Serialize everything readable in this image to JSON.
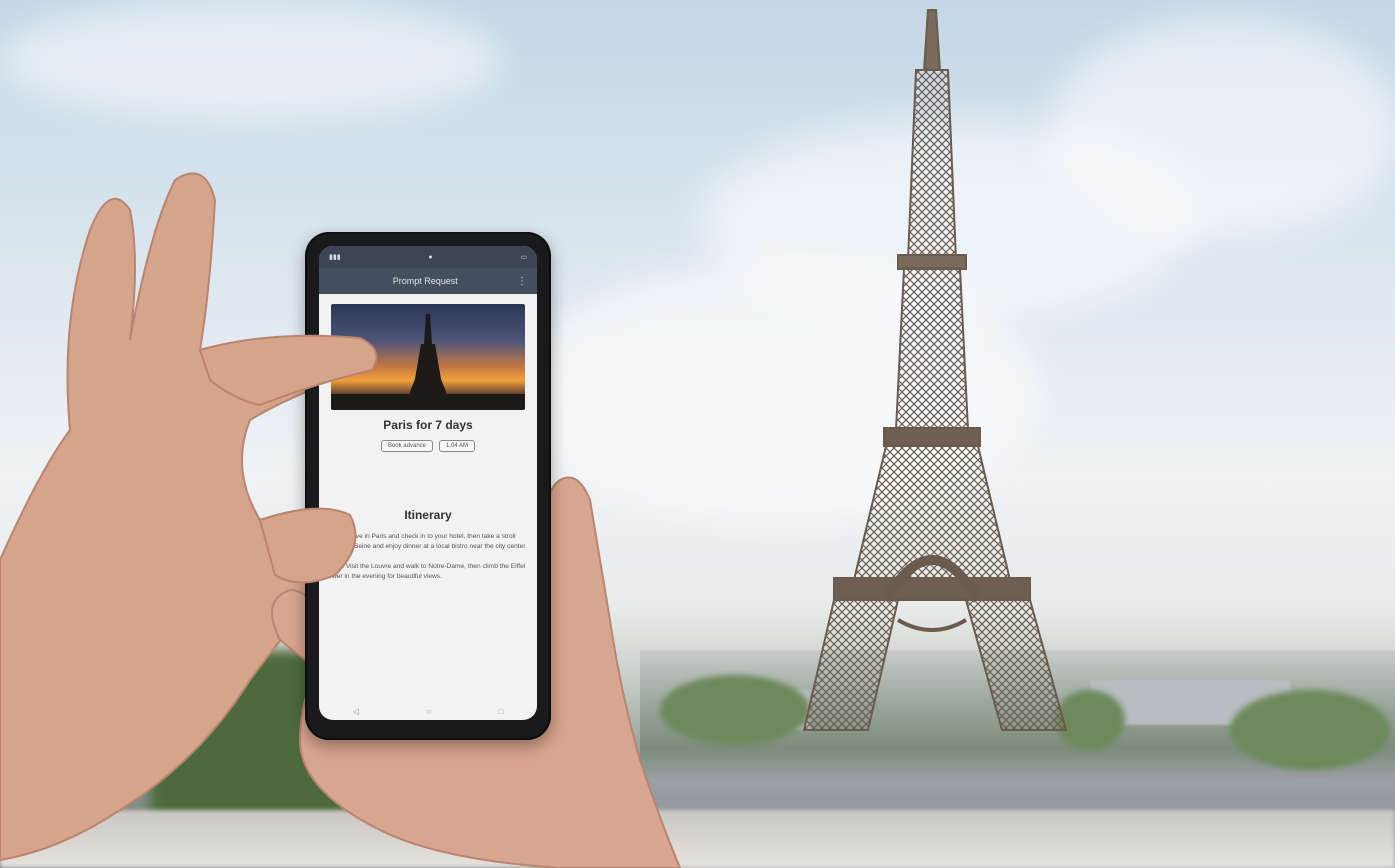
{
  "phone": {
    "status_time": "",
    "app_title": "Prompt Request",
    "trip": {
      "title": "Paris for 7 days",
      "chips": [
        "Book advance",
        "1.04 AM"
      ]
    },
    "itinerary": {
      "heading": "Itinerary",
      "paragraphs": [
        "Day 1: Arrive in Paris and check in to your hotel, then take a stroll along the Seine and enjoy dinner at a local bistro near the city center.",
        "Day 2: Visit the Louvre and walk to Notre-Dame, then climb the Eiffel Tower in the evening for beautiful views."
      ]
    }
  },
  "colors": {
    "sky": "#c4d7e6",
    "tower": "#7a6a5c",
    "skin": "#d9a58c",
    "phone_body": "#1a1a1c",
    "app_bar": "#44505f"
  }
}
